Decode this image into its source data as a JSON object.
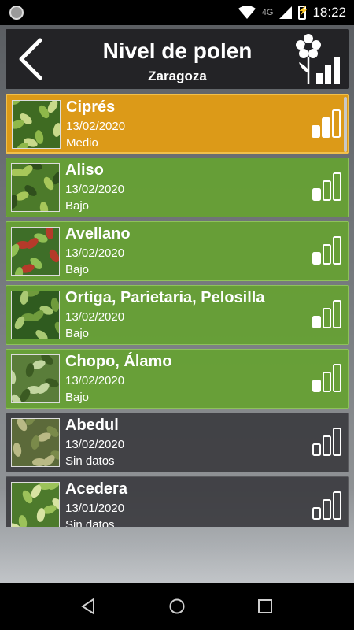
{
  "status": {
    "time": "18:22",
    "network": "4G",
    "icons": [
      "notification-dot-icon",
      "wifi-icon",
      "cell-signal-icon",
      "battery-charging-icon"
    ]
  },
  "header": {
    "title": "Nivel de polen",
    "city": "Zaragoza",
    "back_icon": "chevron-left-icon",
    "logo_icon": "flower-levels-icon"
  },
  "colors": {
    "medio": "#dc9a18",
    "bajo": "#66a034",
    "sin_datos": "#3a3a3e",
    "header": "#232326"
  },
  "plants": [
    {
      "name": "Ciprés",
      "date": "13/02/2020",
      "level": "Medio",
      "filled_bars": 2,
      "status": "medio"
    },
    {
      "name": "Aliso",
      "date": "13/02/2020",
      "level": "Bajo",
      "filled_bars": 1,
      "status": "bajo"
    },
    {
      "name": "Avellano",
      "date": "13/02/2020",
      "level": "Bajo",
      "filled_bars": 1,
      "status": "bajo"
    },
    {
      "name": "Ortiga, Parietaria, Pelosilla",
      "date": "13/02/2020",
      "level": "Bajo",
      "filled_bars": 1,
      "status": "bajo"
    },
    {
      "name": "Chopo, Álamo",
      "date": "13/02/2020",
      "level": "Bajo",
      "filled_bars": 1,
      "status": "bajo"
    },
    {
      "name": "Abedul",
      "date": "13/02/2020",
      "level": "Sin datos",
      "filled_bars": 0,
      "status": "sin"
    },
    {
      "name": "Acedera",
      "date": "13/01/2020",
      "level": "Sin datos",
      "filled_bars": 0,
      "status": "sin"
    }
  ],
  "nav": {
    "back_icon": "triangle-back-icon",
    "home_icon": "circle-home-icon",
    "recents_icon": "square-recents-icon"
  }
}
